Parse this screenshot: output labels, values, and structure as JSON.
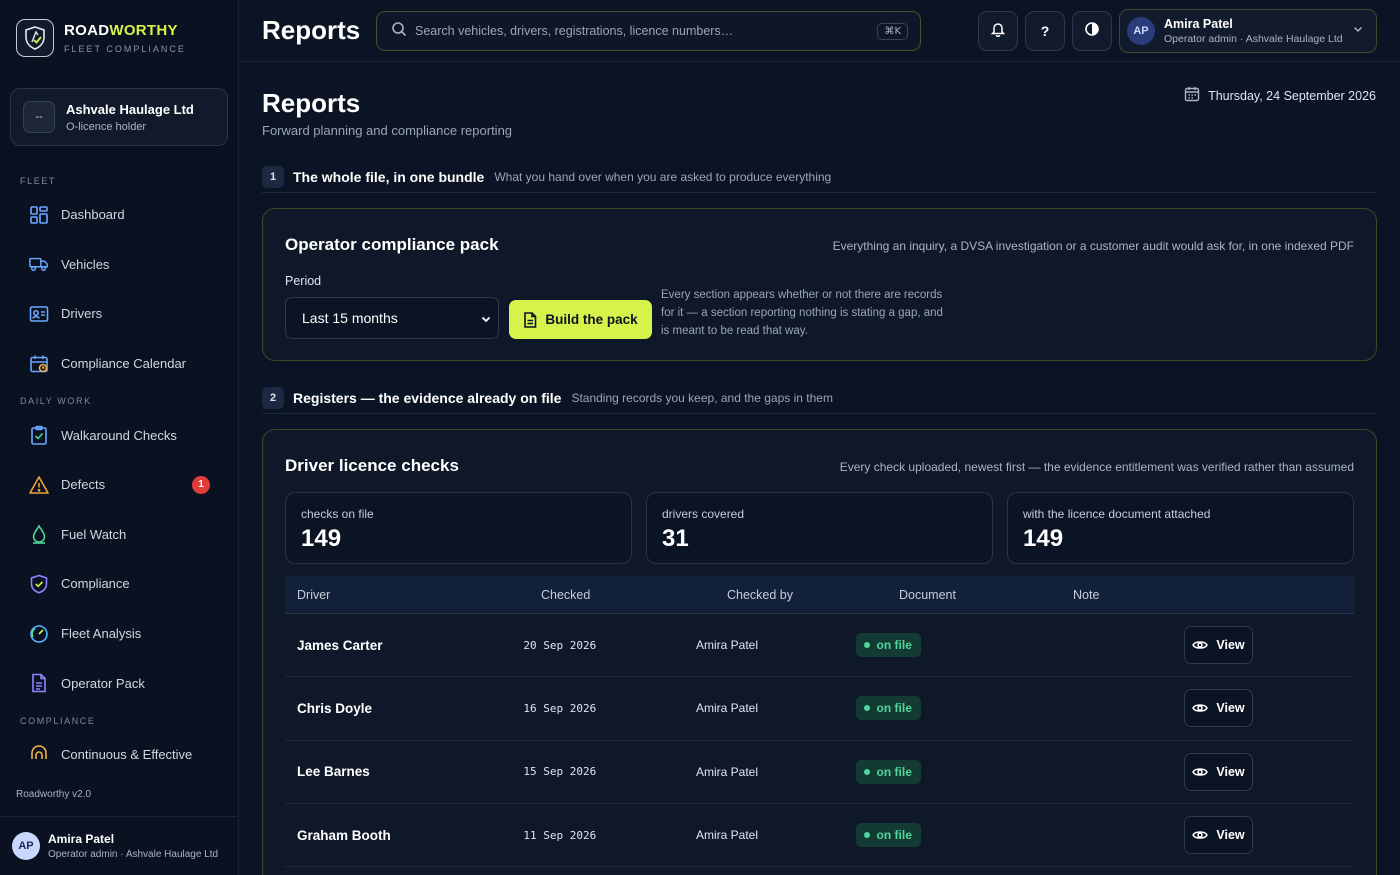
{
  "brand": {
    "name_a": "ROAD",
    "name_b": "WORTHY",
    "subtitle": "FLEET COMPLIANCE"
  },
  "org": {
    "icon_text": "--",
    "name": "Ashvale Haulage Ltd",
    "role": "O-licence holder"
  },
  "nav": {
    "sections": [
      {
        "label": "FLEET",
        "items": [
          {
            "label": "Dashboard",
            "icon": "dashboard-icon"
          },
          {
            "label": "Vehicles",
            "icon": "truck-icon"
          },
          {
            "label": "Drivers",
            "icon": "id-card-icon"
          },
          {
            "label": "Compliance Calendar",
            "icon": "calendar-icon"
          }
        ]
      },
      {
        "label": "DAILY WORK",
        "items": [
          {
            "label": "Walkaround Checks",
            "icon": "clipboard-check-icon"
          },
          {
            "label": "Defects",
            "icon": "warning-icon",
            "badge": "1"
          },
          {
            "label": "Fuel Watch",
            "icon": "fuel-drop-icon"
          },
          {
            "label": "Compliance",
            "icon": "shield-check-icon"
          },
          {
            "label": "Fleet Analysis",
            "icon": "gauge-icon"
          },
          {
            "label": "Operator Pack",
            "icon": "document-icon"
          }
        ]
      },
      {
        "label": "COMPLIANCE",
        "items": [
          {
            "label": "Continuous & Effective",
            "icon": "loop-icon"
          }
        ]
      }
    ]
  },
  "version": "Roadworthy v2.0",
  "user": {
    "initials": "AP",
    "name": "Amira Patel",
    "role": "Operator admin · Ashvale Haulage Ltd"
  },
  "header": {
    "title": "Reports",
    "search_placeholder": "Search vehicles, drivers, registrations, licence numbers…",
    "search_shortcut": "⌘K",
    "help_label": "?"
  },
  "page": {
    "title": "Reports",
    "subtitle": "Forward planning and compliance reporting",
    "date": "Thursday, 24 September 2026"
  },
  "section1": {
    "num": "1",
    "title": "The whole file, in one bundle",
    "subtitle": "What you hand over when you are asked to produce everything"
  },
  "pack": {
    "title": "Operator compliance pack",
    "note": "Everything an inquiry, a DVSA investigation or a customer audit would ask for, in one indexed PDF",
    "period_label": "Period",
    "period_value": "Last 15 months",
    "build_label": "Build the pack",
    "hint": "Every section appears whether or not there are records for it — a section reporting nothing is stating a gap, and is meant to be read that way."
  },
  "section2": {
    "num": "2",
    "title": "Registers — the evidence already on file",
    "subtitle": "Standing records you keep, and the gaps in them"
  },
  "licence": {
    "title": "Driver licence checks",
    "note": "Every check uploaded, newest first — the evidence entitlement was verified rather than assumed",
    "stats": [
      {
        "label": "checks on file",
        "value": "149"
      },
      {
        "label": "drivers covered",
        "value": "31"
      },
      {
        "label": "with the licence document attached",
        "value": "149"
      }
    ],
    "columns": [
      "Driver",
      "Checked",
      "Checked by",
      "Document",
      "Note"
    ],
    "view_label": "View",
    "rows": [
      {
        "driver": "James Carter",
        "checked": "20 Sep 2026",
        "by": "Amira Patel",
        "doc": "on file"
      },
      {
        "driver": "Chris Doyle",
        "checked": "16 Sep 2026",
        "by": "Amira Patel",
        "doc": "on file"
      },
      {
        "driver": "Lee Barnes",
        "checked": "15 Sep 2026",
        "by": "Amira Patel",
        "doc": "on file"
      },
      {
        "driver": "Graham Booth",
        "checked": "11 Sep 2026",
        "by": "Amira Patel",
        "doc": "on file"
      }
    ]
  },
  "colors": {
    "accent": "#d7f24a",
    "badge": "#e23b3b",
    "ok": "#4fd69a",
    "background": "#0b1424"
  }
}
